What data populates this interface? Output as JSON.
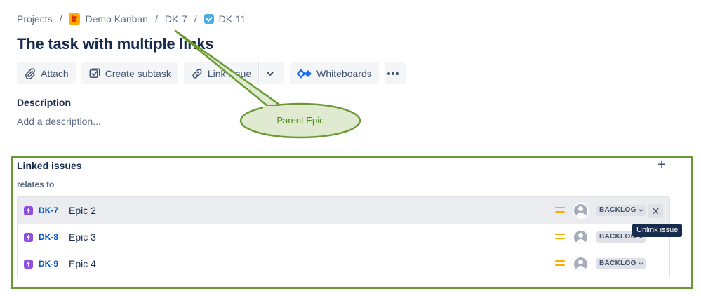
{
  "breadcrumb": {
    "projects": "Projects",
    "project": "Demo Kanban",
    "parent": "DK-7",
    "issue": "DK-11",
    "separator": "/"
  },
  "title": "The task with multiple links",
  "toolbar": {
    "attach": "Attach",
    "create_subtask": "Create subtask",
    "link_issue": "Link issue",
    "whiteboards": "Whiteboards",
    "more": "•••"
  },
  "description": {
    "label": "Description",
    "placeholder": "Add a description..."
  },
  "annotation": {
    "callout": "Parent Epic"
  },
  "linked": {
    "title": "Linked issues",
    "add": "+",
    "relation": "relates to",
    "issues": [
      {
        "key": "DK-7",
        "summary": "Epic 2",
        "status": "BACKLOG"
      },
      {
        "key": "DK-8",
        "summary": "Epic 3",
        "status": "BACKLOG"
      },
      {
        "key": "DK-9",
        "summary": "Epic 4",
        "status": "BACKLOG"
      }
    ],
    "unlink_tooltip": "Unlink issue",
    "unlink_symbol": "✕"
  },
  "colors": {
    "accent": "#0052cc",
    "epic": "#904ee2",
    "priority_medium": "#ffab00",
    "annotation": "#6b9a34"
  },
  "icons": {
    "attach": "paperclip-icon",
    "create_subtask": "subtask-icon",
    "link": "link-icon",
    "whiteboards": "whiteboards-icon",
    "priority": "priority-medium-icon"
  }
}
